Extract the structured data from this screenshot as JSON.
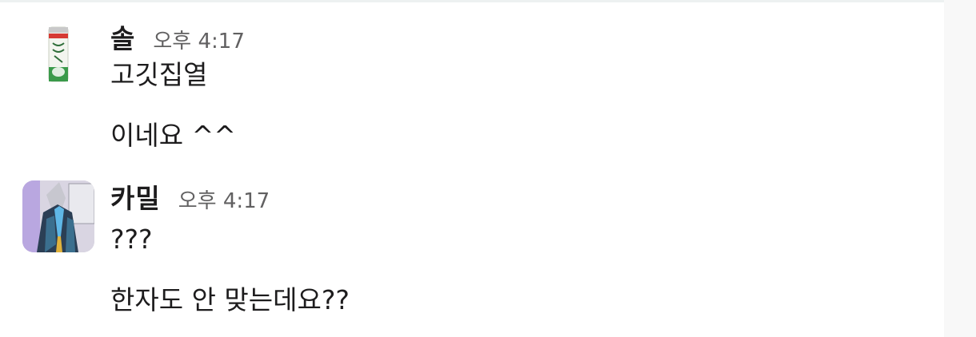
{
  "messages": [
    {
      "sender": "솔",
      "time": "오후 4:17",
      "avatar_icon": "canned-drink-icon",
      "lines": [
        "고깃집열",
        "이네요 ^^"
      ]
    },
    {
      "sender": "카밀",
      "time": "오후 4:17",
      "avatar_icon": "character-portrait-icon",
      "lines": [
        "???",
        "한자도 안 맞는데요??"
      ]
    }
  ]
}
